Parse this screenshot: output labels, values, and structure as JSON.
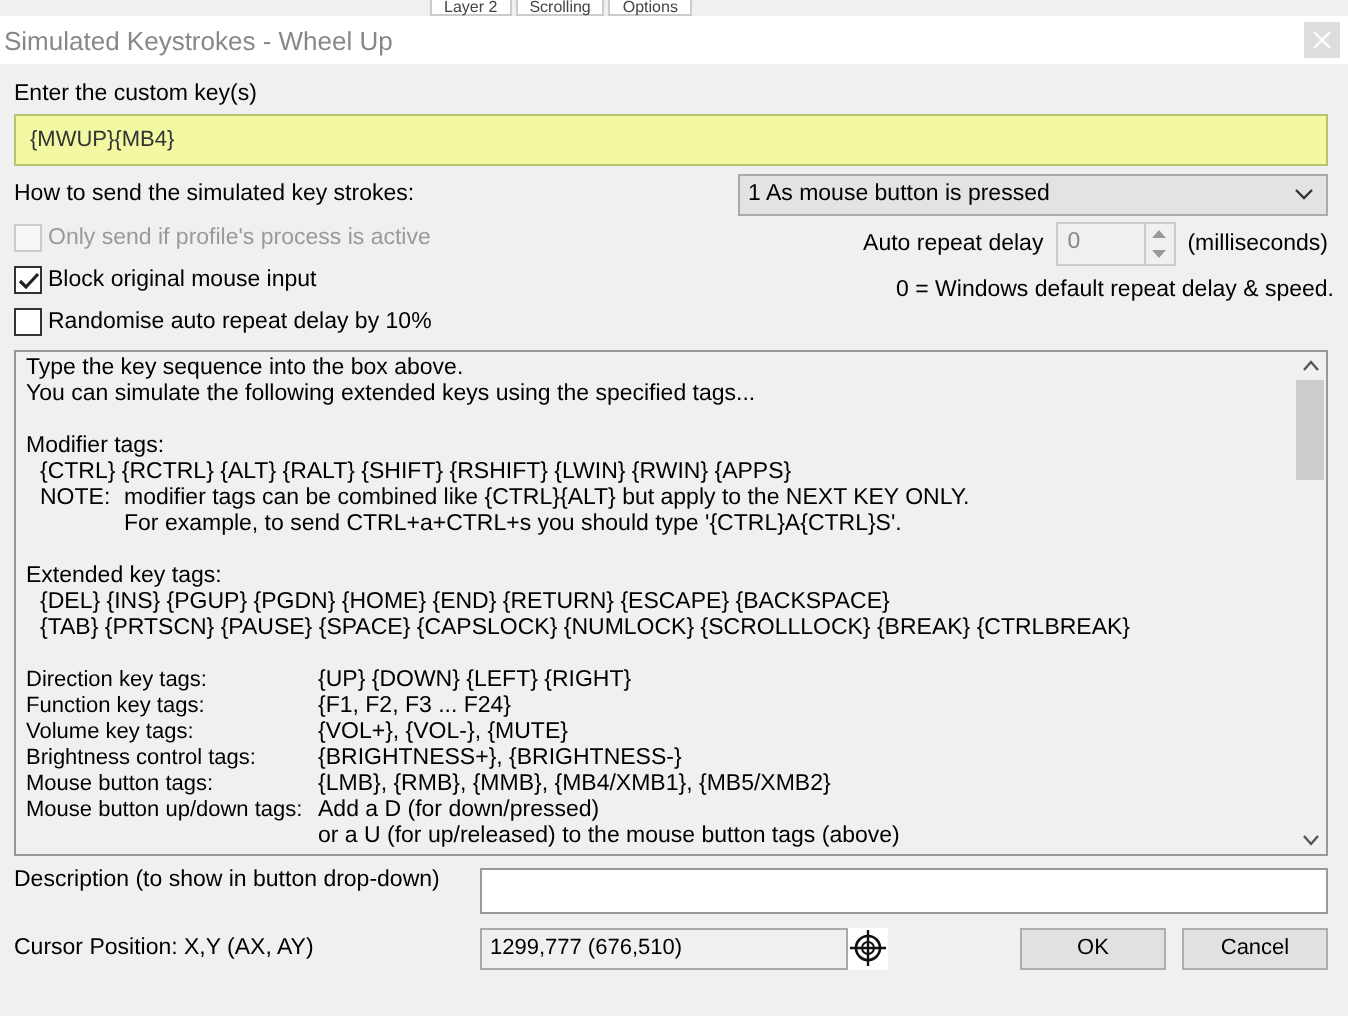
{
  "background_tabs": [
    {
      "label": "Layer 2"
    },
    {
      "label": "Scrolling"
    },
    {
      "label": "Options"
    }
  ],
  "window": {
    "title": "Simulated Keystrokes - Wheel Up"
  },
  "custom_key": {
    "label": "Enter the custom key(s)",
    "value": "{MWUP}{MB4}"
  },
  "send_mode": {
    "label": "How to send the simulated key strokes:",
    "value": "1 As mouse button is pressed"
  },
  "options": [
    {
      "label": "Only send if profile's process is active",
      "checked": false,
      "disabled": true
    },
    {
      "label": "Block original mouse input",
      "checked": true,
      "disabled": false
    },
    {
      "label": "Randomise auto repeat delay by 10%",
      "checked": false,
      "disabled": false
    }
  ],
  "auto_repeat": {
    "label": "Auto repeat delay",
    "value": "0",
    "unit": "(milliseconds)",
    "note": "0 = Windows default repeat delay & speed."
  },
  "help_lines": [
    {
      "kind": "text",
      "text": "Type the key sequence into the box above."
    },
    {
      "kind": "text",
      "text": "You can simulate the following extended keys using the specified tags..."
    },
    {
      "kind": "blank"
    },
    {
      "kind": "text",
      "text": "Modifier tags:"
    },
    {
      "kind": "indent",
      "text": "{CTRL} {RCTRL} {ALT} {RALT} {SHIFT} {RSHIFT} {LWIN} {RWIN} {APPS}"
    },
    {
      "kind": "note",
      "label": "NOTE:",
      "text": "modifier tags can be combined like {CTRL}{ALT} but apply to the NEXT KEY ONLY."
    },
    {
      "kind": "note",
      "text": "For example, to send CTRL+a+CTRL+s you should type '{CTRL}A{CTRL}S'."
    },
    {
      "kind": "blank"
    },
    {
      "kind": "text",
      "text": "Extended key tags:"
    },
    {
      "kind": "indent",
      "text": "{DEL} {INS} {PGUP} {PGDN} {HOME} {END} {RETURN} {ESCAPE} {BACKSPACE}"
    },
    {
      "kind": "indent",
      "text": "{TAB} {PRTSCN} {PAUSE} {SPACE} {CAPSLOCK} {NUMLOCK} {SCROLLLOCK} {BREAK} {CTRLBREAK}"
    },
    {
      "kind": "blank"
    },
    {
      "kind": "pair",
      "label": "Direction key tags:",
      "text": "{UP} {DOWN} {LEFT} {RIGHT}"
    },
    {
      "kind": "pair",
      "label": "Function key tags:",
      "text": "{F1, F2, F3 ... F24}"
    },
    {
      "kind": "pair",
      "label": "Volume key tags:",
      "text": "{VOL+}, {VOL-}, {MUTE}"
    },
    {
      "kind": "pair",
      "label": "Brightness control tags:",
      "text": "{BRIGHTNESS+}, {BRIGHTNESS-}"
    },
    {
      "kind": "pair",
      "label": "Mouse button tags:",
      "text": "{LMB}, {RMB}, {MMB}, {MB4/XMB1}, {MB5/XMB2}"
    },
    {
      "kind": "pair",
      "label": "Mouse button up/down tags:",
      "text": "Add a D (for down/pressed)"
    },
    {
      "kind": "pair",
      "text": "or a U (for up/released) to the mouse button tags (above)"
    }
  ],
  "description": {
    "label": "Description (to show in button drop-down)"
  },
  "cursor": {
    "label": "Cursor Position: X,Y (AX, AY)",
    "value": "1299,777 (676,510)"
  },
  "buttons": [
    {
      "label": "OK"
    },
    {
      "label": "Cancel"
    }
  ]
}
